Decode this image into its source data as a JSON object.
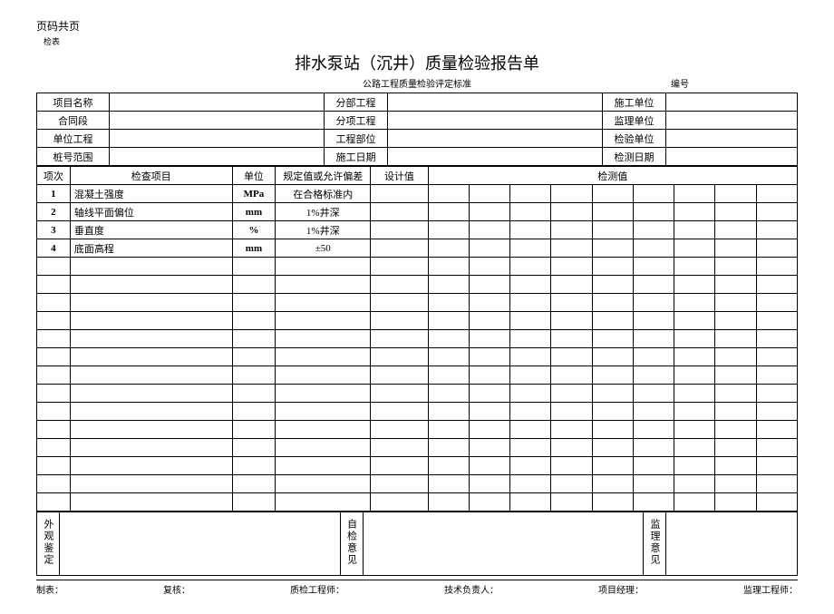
{
  "header": {
    "page_label": "页码共页",
    "sub_label": "检表",
    "title": "排水泵站（沉井）质量检验报告单",
    "standard": "公路工程质量检验评定标准",
    "serial_prefix": "编号"
  },
  "info_labels": {
    "project_name": "项目名称",
    "sub_project": "分部工程",
    "construct_unit": "施工单位",
    "contract": "合同段",
    "sub_item": "分项工程",
    "supervise_unit": "监理单位",
    "unit_project": "单位工程",
    "project_part": "工程部位",
    "inspect_unit": "检验单位",
    "pile_range": "桩号范围",
    "construct_date": "施工日期",
    "detect_date": "检测日期"
  },
  "check_headers": {
    "seq": "项次",
    "item": "检查项目",
    "unit": "单位",
    "tolerance": "规定值或允许偏差",
    "design": "设计值",
    "detect": "检测值"
  },
  "check_rows": [
    {
      "seq": "1",
      "item": "混凝土强度",
      "unit": "MPa",
      "tolerance": "在合格标准内"
    },
    {
      "seq": "2",
      "item": "轴线平面偏位",
      "unit": "mm",
      "tolerance": "1%井深"
    },
    {
      "seq": "3",
      "item": "垂直度",
      "unit": "%",
      "tolerance": "1%井深"
    },
    {
      "seq": "4",
      "item": "底面高程",
      "unit": "mm",
      "tolerance": "±50"
    }
  ],
  "bottom_labels": {
    "appearance": "外观鉴定",
    "self_check": "自检意见",
    "supervise_opinion": "监理意见"
  },
  "signatures": {
    "maker": "制表：",
    "reviewer": "复核：",
    "qc_engineer": "质检工程师：",
    "tech_lead": "技术负责人：",
    "pm": "项目经理：",
    "supervise_engineer": "监理工程师："
  }
}
